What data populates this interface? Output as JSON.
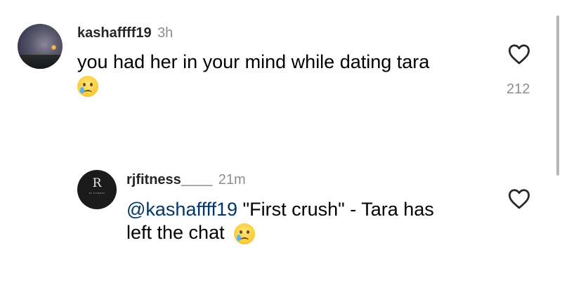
{
  "comments": [
    {
      "username": "kashaffff19",
      "timestamp": "3h",
      "text": "you had her in your mind while dating tara",
      "emoji": "crying-face",
      "like_count": "212"
    }
  ],
  "reply": {
    "username": "rjfitness____",
    "timestamp": "21m",
    "mention": "@kashaffff19",
    "text_line1": " \"First crush\" - Tara has",
    "text_line2": "left the chat",
    "emoji": "crying-face",
    "avatar_monogram": "R",
    "avatar_brand": "RJ FITNESS"
  },
  "colors": {
    "username": "#262626",
    "timestamp": "#8e8e8e",
    "mention": "#00376b",
    "icon": "#262626"
  },
  "icons": [
    "heart-outline-icon",
    "crying-face-emoji"
  ]
}
